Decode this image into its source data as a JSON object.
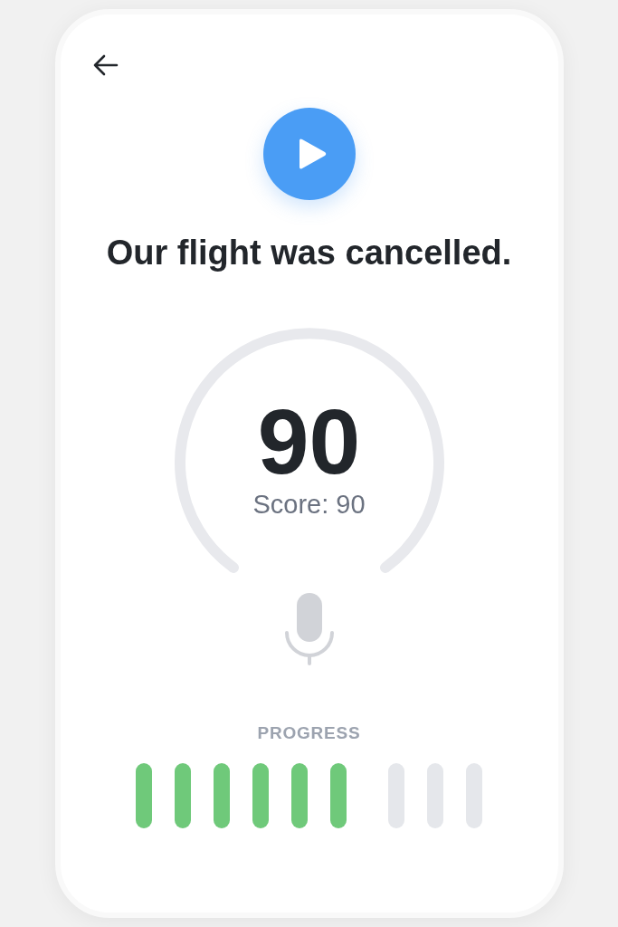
{
  "prompt": {
    "sentence": "Our flight was cancelled."
  },
  "score": {
    "value": "90",
    "label": "Score: 90"
  },
  "progress": {
    "label": "PROGRESS",
    "segments": [
      {
        "done": true
      },
      {
        "done": true
      },
      {
        "done": true
      },
      {
        "done": true
      },
      {
        "done": true
      },
      {
        "done": true
      },
      {
        "done": false
      },
      {
        "done": false
      },
      {
        "done": false
      }
    ]
  }
}
